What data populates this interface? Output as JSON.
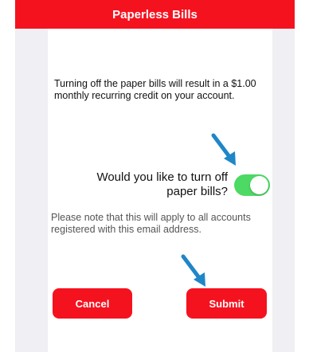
{
  "header": {
    "title": "Paperless Bills",
    "background_color": "#f5121f"
  },
  "content": {
    "info_text": "Turning off the paper bills will result in a $1.00 monthly recurring credit on your account.",
    "question": "Would you like to turn off paper bills?",
    "toggle": {
      "state": "on",
      "on_color": "#4cd964"
    },
    "note_text": "Please note that this will apply to all accounts registered with this email address."
  },
  "buttons": {
    "cancel_label": "Cancel",
    "submit_label": "Submit",
    "button_color": "#f5121f"
  },
  "annotations": {
    "arrow_color": "#1f86c7",
    "arrow_icon": "arrow-down-right-icon"
  }
}
